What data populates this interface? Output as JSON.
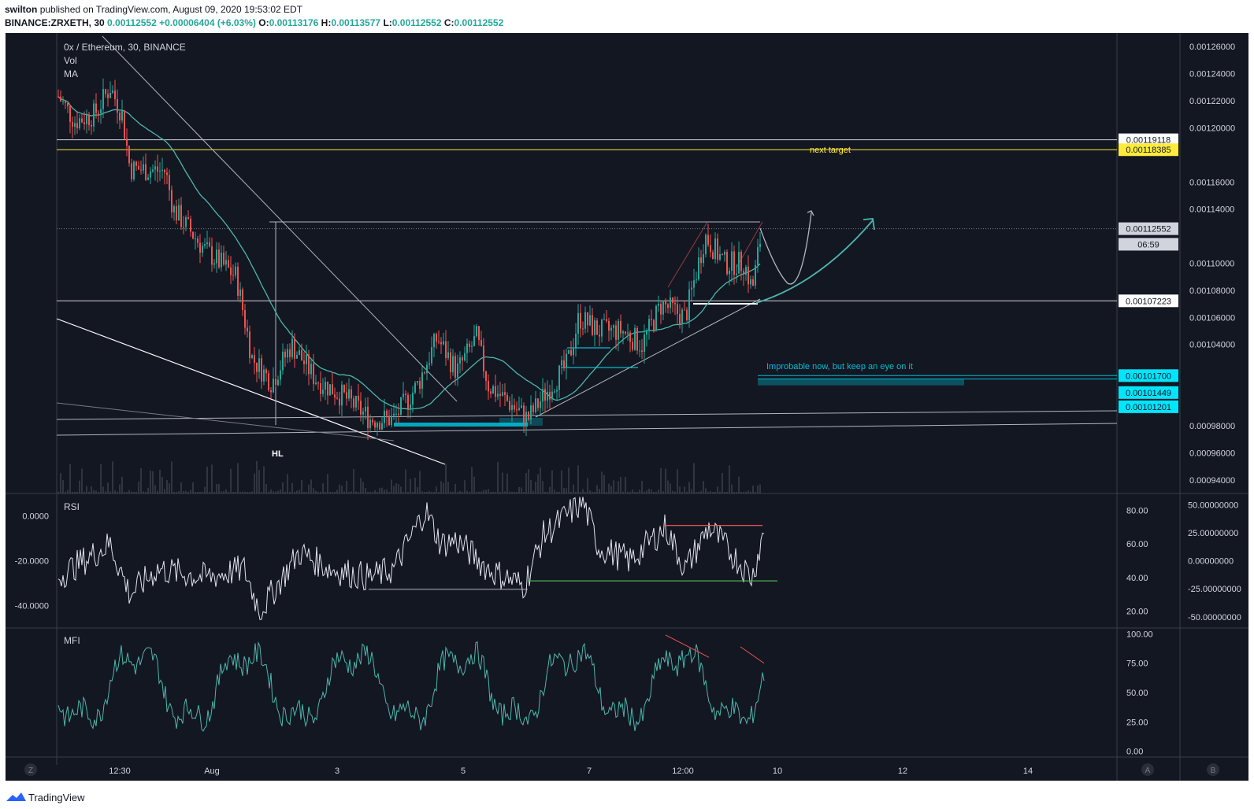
{
  "header": {
    "user": "swilton",
    "published_text": "published on TradingView.com, August 09, 2020 19:53:02 EDT",
    "symbol": "BINANCE:ZRXETH, 30",
    "last": "0.00112552",
    "change": "+0.00006404 (+6.03%)",
    "o_label": "O:",
    "o": "0.00113176",
    "h_label": "H:",
    "h": "0.00113577",
    "l_label": "L:",
    "l": "0.00112552",
    "c_label": "C:",
    "c": "0.00112552"
  },
  "legend": {
    "title": "0x / Ethereum, 30, BINANCE",
    "vol": "Vol",
    "ma": "MA"
  },
  "annotations": {
    "next_target": "next target",
    "improbable": "Improbable now, but keep an eye on it",
    "hl": "HL"
  },
  "price_axis": {
    "ticks": [
      "0.00126000",
      "0.00124000",
      "0.00122000",
      "0.00120000",
      "0.00116000",
      "0.00114000",
      "0.00110000",
      "0.00108000",
      "0.00106000",
      "0.00104000",
      "0.00098000",
      "0.00096000",
      "0.00094000"
    ],
    "tick_values": [
      0.00126,
      0.00124,
      0.00122,
      0.0012,
      0.00116,
      0.00114,
      0.0011,
      0.00108,
      0.00106,
      0.00104,
      0.00098,
      0.00096,
      0.00094
    ],
    "labels": [
      {
        "text": "0.00119118",
        "value": 0.00119118,
        "bg": "#ffffff",
        "fg": "#131722"
      },
      {
        "text": "0.00118385",
        "value": 0.00118385,
        "bg": "#ffeb3b",
        "fg": "#131722"
      },
      {
        "text": "0.00112552",
        "value": 0.00112552,
        "bg": "#d1d4dc",
        "fg": "#131722"
      },
      {
        "text": "06:59",
        "value": 0.001114,
        "bg": "#d1d4dc",
        "fg": "#131722"
      },
      {
        "text": "0.00107223",
        "value": 0.00107223,
        "bg": "#ffffff",
        "fg": "#131722"
      },
      {
        "text": "0.00101700",
        "value": 0.001017,
        "bg": "#00e5ff",
        "fg": "#131722"
      },
      {
        "text": "0.00101449",
        "value": 0.00100449,
        "bg": "#00e5ff",
        "fg": "#131722"
      },
      {
        "text": "0.00101201",
        "value": 0.00099401,
        "bg": "#00e5ff",
        "fg": "#131722"
      }
    ]
  },
  "rsi": {
    "label": "RSI",
    "left_ticks": [
      "0.0000",
      "-20.0000",
      "-40.0000"
    ],
    "right_ticks": [
      "80.00",
      "60.00",
      "40.00",
      "20.00"
    ],
    "far_right_ticks": [
      "50.00000000",
      "25.00000000",
      "0.00000000",
      "-25.00000000",
      "-50.00000000"
    ]
  },
  "mfi": {
    "label": "MFI",
    "right_ticks": [
      "100.00",
      "75.00",
      "50.00",
      "25.00",
      "0.00"
    ]
  },
  "time_axis": {
    "labels": [
      "12:30",
      "Aug",
      "3",
      "5",
      "7",
      "12:00",
      "10",
      "12",
      "14"
    ],
    "left_button": "Z",
    "right_buttons": [
      "A",
      "B"
    ]
  },
  "footer": {
    "brand": "TradingView"
  },
  "colors": {
    "background": "#131722",
    "up": "#26a69a",
    "down": "#ef5350",
    "ma": "#4db6ac",
    "target": "#ffeb3b",
    "zone": "#00bcd4"
  },
  "chart_data": {
    "type": "candlestick",
    "title": "0x / Ethereum, 30, BINANCE",
    "price_range": [
      0.00093,
      0.00127
    ],
    "key_levels": [
      0.00119118,
      0.00118385,
      0.00107223,
      0.001017,
      0.00101449,
      0.00101201
    ],
    "last_price": 0.00112552,
    "rsi_range": [
      10,
      90
    ],
    "mfi_range": [
      -5,
      105
    ]
  }
}
